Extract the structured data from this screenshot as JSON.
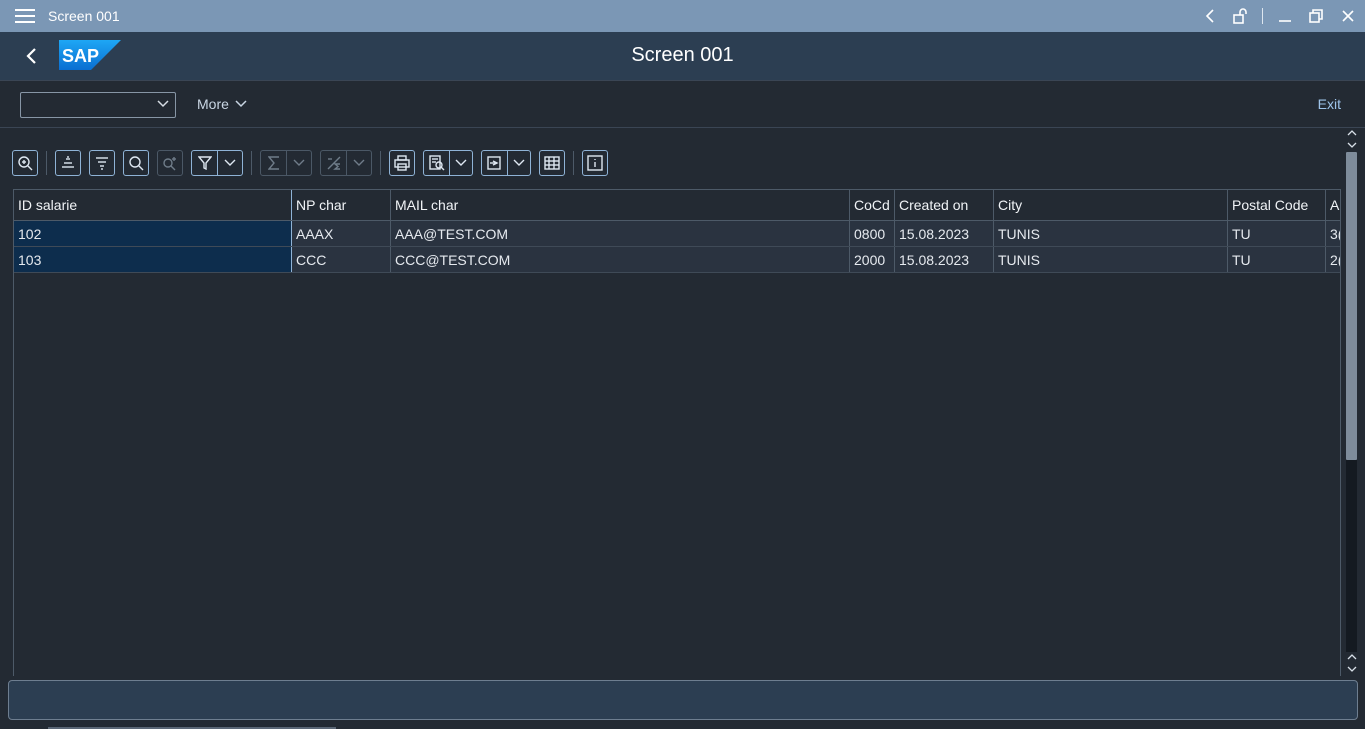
{
  "window": {
    "title": "Screen 001"
  },
  "header": {
    "title": "Screen 001",
    "logo_text": "SAP"
  },
  "toolbar": {
    "command_field_value": "",
    "more_label": "More",
    "exit_label": "Exit"
  },
  "alv_toolbar": {
    "icons": [
      "details-icon",
      "sort-ascending-icon",
      "sort-descending-icon",
      "find-icon",
      "find-next-icon",
      "filter-icon",
      "sum-icon",
      "subtotals-icon",
      "print-icon",
      "views-icon",
      "export-icon",
      "layout-icon",
      "info-icon"
    ]
  },
  "grid": {
    "columns": [
      "ID salarie",
      "NP char",
      "MAIL char",
      "CoCd",
      "Created on",
      "City",
      "Postal Code",
      "A"
    ],
    "rows": [
      [
        "102",
        "AAAX",
        "AAA@TEST.COM",
        "0800",
        "15.08.2023",
        "TUNIS",
        "TU",
        "3("
      ],
      [
        "103",
        "CCC",
        "CCC@TEST.COM",
        "2000",
        "15.08.2023",
        "TUNIS",
        "TU",
        "2("
      ]
    ]
  },
  "colors": {
    "titlebar": "#7b97b5",
    "header": "#2c3e52",
    "background": "#232a33",
    "key_cell": "#0d2d4d",
    "accent_link": "#9ec4ea"
  }
}
